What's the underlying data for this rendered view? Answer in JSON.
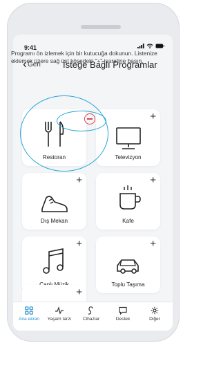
{
  "status": {
    "time": "9:41"
  },
  "nav": {
    "back_label": "Geri",
    "title": "İsteğe Bağlı Programlar"
  },
  "description": "Programı ön izlemek için bir kutucuğa dokunun. Listenize eklemek üzere sağ üst köşedeki \"+\" işaretine basın.",
  "programs": [
    {
      "label": "Restoran",
      "icon": "restaurant-icon",
      "state": "added"
    },
    {
      "label": "Televizyon",
      "icon": "tv-icon",
      "state": "add"
    },
    {
      "label": "Dış Mekan",
      "icon": "shoe-icon",
      "state": "add"
    },
    {
      "label": "Kafe",
      "icon": "coffee-cup-icon",
      "state": "add"
    },
    {
      "label": "Canlı Müzik",
      "icon": "music-note-icon",
      "state": "add"
    },
    {
      "label": "Toplu Taşıma",
      "icon": "car-icon",
      "state": "add"
    },
    {
      "label": "",
      "icon": "",
      "state": "add"
    }
  ],
  "plus_symbol": "+",
  "tabs": [
    {
      "label": "Ana ekran",
      "icon": "grid-icon",
      "active": true
    },
    {
      "label": "Yaşam tarzı",
      "icon": "pulse-icon",
      "active": false
    },
    {
      "label": "Cihazlar",
      "icon": "hearing-aid-icon",
      "active": false
    },
    {
      "label": "Destek",
      "icon": "chat-icon",
      "active": false
    },
    {
      "label": "Diğer",
      "icon": "gear-icon",
      "active": false
    }
  ],
  "colors": {
    "accent": "#1f8fcf",
    "annotation": "#2aa6d8",
    "remove": "#d5474f"
  }
}
